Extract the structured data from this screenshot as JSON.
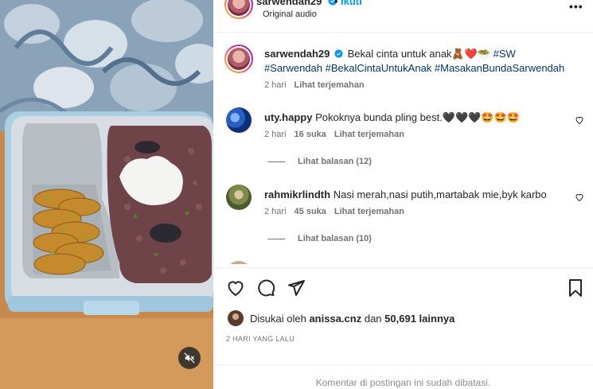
{
  "header": {
    "username": "sarwendah29",
    "follow_label": "Ikuti",
    "audio": "Original audio",
    "more_icon": "•••"
  },
  "caption": {
    "username": "sarwendah29",
    "text": "Bekal cinta untuk anak🧸❤️🥗",
    "hashtags_line1": "#SW",
    "hashtags_line2": "#Sarwendah #BekalCintaUntukAnak #MasakanBundaSarwendah",
    "time": "2 hari",
    "translate": "Lihat terjemahan"
  },
  "comments": [
    {
      "username": "uty.happy",
      "text": "Pokoknya bunda pling best.🖤🖤🖤🤩🤩🤩",
      "time": "2 hari",
      "likes": "16 suka",
      "translate": "Lihat terjemahan",
      "replies": "Lihat balasan (12)"
    },
    {
      "username": "rahmikrlindth",
      "text": "Nasi merah,nasi putih,martabak mie,byk karbo",
      "time": "2 hari",
      "likes": "45 suka",
      "translate": "Lihat terjemahan",
      "replies": "Lihat balasan (10)"
    }
  ],
  "likes": {
    "prefix": "Disukai oleh",
    "user": "anissa.cnz",
    "connector": "dan",
    "count": "50,691 lainnya"
  },
  "date": "2 HARI YANG LALU",
  "comments_limited": "Komentar di postingan ini sudah dibatasi.",
  "colors": {
    "link_blue": "#0095f6",
    "hashtag": "#00376b",
    "muted": "#737373",
    "verified": "#0095f6"
  },
  "icons": [
    "verified-badge-icon",
    "heart-icon",
    "comment-icon",
    "share-icon",
    "bookmark-icon",
    "mute-icon"
  ]
}
